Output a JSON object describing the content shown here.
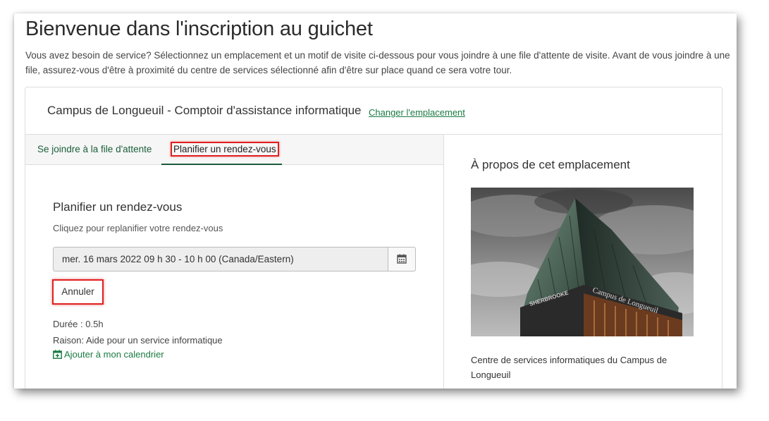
{
  "page": {
    "title": "Bienvenue dans l'inscription au guichet",
    "intro": "Vous avez besoin de service? Sélectionnez un emplacement et un motif de visite ci-dessous pour vous joindre à une file d'attente de visite. Avant de vous joindre à une file, assurez-vous d'être à proximité du centre de services sélectionné afin d'être sur place quand ce sera votre tour."
  },
  "location": {
    "name": "Campus de Longueuil - Comptoir d'assistance informatique",
    "change_link": "Changer l'emplacement"
  },
  "tabs": [
    {
      "label": "Se joindre à la file d'attente",
      "active": false
    },
    {
      "label": "Planifier un rendez-vous",
      "active": true
    }
  ],
  "schedule": {
    "title": "Planifier un rendez-vous",
    "help": "Cliquez pour replanifier votre rendez-vous",
    "date_value": "mer. 16 mars 2022 09 h 30 - 10 h 00 (Canada/Eastern)",
    "cancel_label": "Annuler",
    "duration": "Durée : 0.5h",
    "reason": "Raison: Aide pour un service informatique",
    "add_calendar": "Ajouter à mon calendrier"
  },
  "about": {
    "title": "À propos de cet emplacement",
    "description": "Centre de services informatiques du Campus de Longueuil",
    "building_sign": "Campus de Longueuil",
    "building_sign_2": "SHERBROOKE"
  },
  "icons": {
    "calendar": "calendar-icon",
    "calendar_plus": "calendar-plus-icon"
  },
  "colors": {
    "link_green": "#1a7a43",
    "active_tab_underline": "#1d5a3c",
    "highlight_red": "#e02020"
  }
}
